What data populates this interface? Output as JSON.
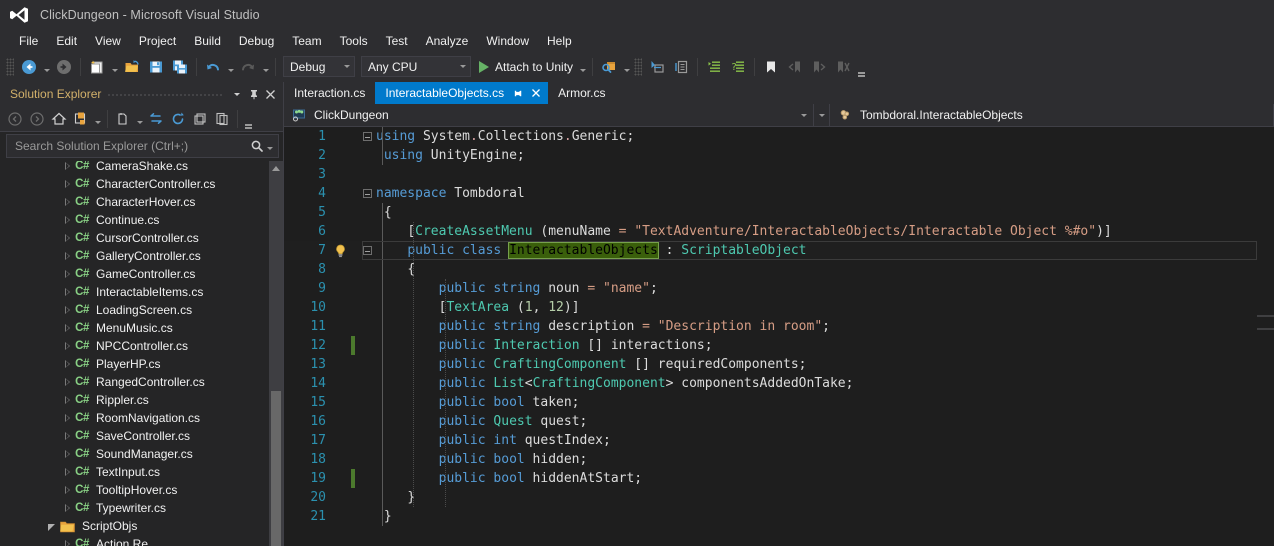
{
  "window": {
    "title": "ClickDungeon - Microsoft Visual Studio",
    "logo_icon": "visual-studio-logo"
  },
  "menubar": {
    "items": [
      {
        "label": "File"
      },
      {
        "label": "Edit"
      },
      {
        "label": "View"
      },
      {
        "label": "Project"
      },
      {
        "label": "Build"
      },
      {
        "label": "Debug"
      },
      {
        "label": "Team"
      },
      {
        "label": "Tools"
      },
      {
        "label": "Test"
      },
      {
        "label": "Analyze"
      },
      {
        "label": "Window"
      },
      {
        "label": "Help"
      }
    ]
  },
  "toolbar": {
    "navigate_back_icon": "navigate-back-icon",
    "navigate_forward_icon": "navigate-forward-icon",
    "new_project_icon": "new-project-icon",
    "open_file_icon": "open-file-icon",
    "save_icon": "save-icon",
    "save_all_icon": "save-all-icon",
    "undo_icon": "undo-icon",
    "redo_icon": "redo-icon",
    "config_value": "Debug",
    "platform_value": "Any CPU",
    "run_label": "Attach to Unity",
    "run_icon": "play-icon",
    "find_icon": "find-in-files-icon",
    "step_icon": "step-into-icon",
    "doc_outline_icon": "document-outline-icon",
    "indent_icon": "indent-icon",
    "comment_icon": "comment-icon",
    "bookmark_icon": "bookmark-icon",
    "prev_bookmark_icon": "previous-bookmark-icon",
    "next_bookmark_icon": "next-bookmark-icon",
    "clear_bookmarks_icon": "clear-bookmarks-icon",
    "overflow_icon": "toolbar-overflow-icon"
  },
  "solution_explorer": {
    "title": "Solution Explorer",
    "dropdown_icon": "chevron-down-icon",
    "pin_icon": "pin-icon",
    "close_icon": "close-icon",
    "toolbar": {
      "back_icon": "back-icon",
      "forward_icon": "forward-icon",
      "home_icon": "home-icon",
      "pending_changes_icon": "pending-changes-icon",
      "pending_dropdown_icon": "chevron-down-icon",
      "show_all_files_icon": "show-all-files-icon",
      "show_all_dropdown_icon": "chevron-down-icon",
      "sync_icon": "sync-with-active-document-icon",
      "refresh_icon": "refresh-icon",
      "collapse_all_icon": "collapse-all-icon",
      "properties_icon": "properties-icon",
      "overflow_icon": "toolbar-overflow-icon"
    },
    "search": {
      "placeholder": "Search Solution Explorer (Ctrl+;)",
      "value": "",
      "search_icon": "search-icon",
      "dropdown_icon": "chevron-down-icon"
    },
    "tree": [
      {
        "label": "CameraShake.cs",
        "type": "cs",
        "expander": "collapsed",
        "indent": 3
      },
      {
        "label": "CharacterController.cs",
        "type": "cs",
        "expander": "collapsed",
        "indent": 3
      },
      {
        "label": "CharacterHover.cs",
        "type": "cs",
        "expander": "collapsed",
        "indent": 3
      },
      {
        "label": "Continue.cs",
        "type": "cs",
        "expander": "collapsed",
        "indent": 3
      },
      {
        "label": "CursorController.cs",
        "type": "cs",
        "expander": "collapsed",
        "indent": 3
      },
      {
        "label": "GalleryController.cs",
        "type": "cs",
        "expander": "collapsed",
        "indent": 3
      },
      {
        "label": "GameController.cs",
        "type": "cs",
        "expander": "collapsed",
        "indent": 3
      },
      {
        "label": "InteractableItems.cs",
        "type": "cs",
        "expander": "collapsed",
        "indent": 3
      },
      {
        "label": "LoadingScreen.cs",
        "type": "cs",
        "expander": "collapsed",
        "indent": 3
      },
      {
        "label": "MenuMusic.cs",
        "type": "cs",
        "expander": "collapsed",
        "indent": 3
      },
      {
        "label": "NPCController.cs",
        "type": "cs",
        "expander": "collapsed",
        "indent": 3
      },
      {
        "label": "PlayerHP.cs",
        "type": "cs",
        "expander": "collapsed",
        "indent": 3
      },
      {
        "label": "RangedController.cs",
        "type": "cs",
        "expander": "collapsed",
        "indent": 3
      },
      {
        "label": "Rippler.cs",
        "type": "cs",
        "expander": "collapsed",
        "indent": 3
      },
      {
        "label": "RoomNavigation.cs",
        "type": "cs",
        "expander": "collapsed",
        "indent": 3
      },
      {
        "label": "SaveController.cs",
        "type": "cs",
        "expander": "collapsed",
        "indent": 3
      },
      {
        "label": "SoundManager.cs",
        "type": "cs",
        "expander": "collapsed",
        "indent": 3
      },
      {
        "label": "TextInput.cs",
        "type": "cs",
        "expander": "collapsed",
        "indent": 3
      },
      {
        "label": "TooltipHover.cs",
        "type": "cs",
        "expander": "collapsed",
        "indent": 3
      },
      {
        "label": "Typewriter.cs",
        "type": "cs",
        "expander": "collapsed",
        "indent": 3
      },
      {
        "label": "ScriptObjs",
        "type": "folder",
        "expander": "expanded",
        "indent": 2
      },
      {
        "label": "Action.Re",
        "type": "cs",
        "expander": "collapsed",
        "indent": 3
      }
    ],
    "scrollbar": {
      "up_arrow_icon": "scroll-up-arrow-icon"
    }
  },
  "editor": {
    "tabs": [
      {
        "label": "Interaction.cs",
        "active": false
      },
      {
        "label": "InteractableObjects.cs",
        "active": true,
        "pin_icon": "pin-icon",
        "close_icon": "close-icon"
      },
      {
        "label": "Armor.cs",
        "active": false
      }
    ],
    "navbar": {
      "project_value": "ClickDungeon",
      "project_icon": "project-icon",
      "project_dropdown_icon": "chevron-down-icon",
      "type_value": "Tombdoral.InteractableObjects",
      "type_icon": "class-icon",
      "type_dropdown_icon": "chevron-down-icon"
    },
    "colors": {
      "background": "#1e1e1e",
      "line_number": "#2b91af",
      "keyword": "#569cd6",
      "type": "#4ec9b0",
      "string": "#d69d85",
      "number": "#b5cea8",
      "plain": "#dcdcdc",
      "selection_highlight": "#3a5f0b",
      "change_bar": "#4c7a2d",
      "tab_active": "#007acc"
    },
    "lines": [
      {
        "n": 1,
        "fold": "collapse-minus",
        "indent_guides": 0,
        "tokens": [
          {
            "t": "using ",
            "c": "kw"
          },
          {
            "t": "System",
            "c": "pln"
          },
          {
            "t": ".",
            "c": "dot"
          },
          {
            "t": "Collections",
            "c": "pln"
          },
          {
            "t": ".",
            "c": "dot"
          },
          {
            "t": "Generic",
            "c": "pln"
          },
          {
            "t": ";",
            "c": "pln"
          }
        ]
      },
      {
        "n": 2,
        "fold": "",
        "indent_guides": 0,
        "tokens": [
          {
            "t": "using ",
            "c": "kw"
          },
          {
            "t": "UnityEngine;",
            "c": "pln"
          }
        ]
      },
      {
        "n": 3,
        "fold": "",
        "indent_guides": 0,
        "tokens": []
      },
      {
        "n": 4,
        "fold": "collapse-minus",
        "indent_guides": 0,
        "tokens": [
          {
            "t": "namespace ",
            "c": "kw"
          },
          {
            "t": "Tombdoral",
            "c": "pln"
          }
        ]
      },
      {
        "n": 5,
        "fold": "",
        "indent_guides": 0,
        "tokens": [
          {
            "t": "{",
            "c": "pln"
          }
        ]
      },
      {
        "n": 6,
        "fold": "",
        "indent_guides": 1,
        "tokens": [
          {
            "t": "[",
            "c": "pln"
          },
          {
            "t": "CreateAssetMenu",
            "c": "typ"
          },
          {
            "t": " (",
            "c": "pln"
          },
          {
            "t": "menuName",
            "c": "pln"
          },
          {
            "t": " = ",
            "c": "str"
          },
          {
            "t": "\"TextAdventure/InteractableObjects/Interactable Object %#o\"",
            "c": "str"
          },
          {
            "t": ")]",
            "c": "pln"
          }
        ]
      },
      {
        "n": 7,
        "fold": "collapse-minus",
        "bulb": true,
        "current": true,
        "indent_guides": 1,
        "tokens": [
          {
            "t": "public class ",
            "c": "kw"
          },
          {
            "t": "InteractableObjects",
            "c": "sel"
          },
          {
            "t": " : ",
            "c": "pln"
          },
          {
            "t": "ScriptableObject",
            "c": "typ"
          }
        ]
      },
      {
        "n": 8,
        "fold": "",
        "indent_guides": 1,
        "tokens": [
          {
            "t": "{",
            "c": "pln"
          }
        ]
      },
      {
        "n": 9,
        "fold": "",
        "indent_guides": 2,
        "tokens": [
          {
            "t": "public string ",
            "c": "kw"
          },
          {
            "t": "noun ",
            "c": "pln"
          },
          {
            "t": "= ",
            "c": "str"
          },
          {
            "t": "\"name\"",
            "c": "str"
          },
          {
            "t": ";",
            "c": "pln"
          }
        ]
      },
      {
        "n": 10,
        "fold": "",
        "indent_guides": 2,
        "tokens": [
          {
            "t": "[",
            "c": "pln"
          },
          {
            "t": "TextArea",
            "c": "typ"
          },
          {
            "t": " (",
            "c": "pln"
          },
          {
            "t": "1",
            "c": "num"
          },
          {
            "t": ", ",
            "c": "pln"
          },
          {
            "t": "12",
            "c": "num"
          },
          {
            "t": ")]",
            "c": "pln"
          }
        ]
      },
      {
        "n": 11,
        "fold": "",
        "indent_guides": 2,
        "tokens": [
          {
            "t": "public string ",
            "c": "kw"
          },
          {
            "t": "description ",
            "c": "pln"
          },
          {
            "t": "= ",
            "c": "str"
          },
          {
            "t": "\"Description in room\"",
            "c": "str"
          },
          {
            "t": ";",
            "c": "pln"
          }
        ]
      },
      {
        "n": 12,
        "fold": "",
        "change": true,
        "indent_guides": 2,
        "tokens": [
          {
            "t": "public ",
            "c": "kw"
          },
          {
            "t": "Interaction",
            "c": "typ"
          },
          {
            "t": " [] interactions;",
            "c": "pln"
          }
        ]
      },
      {
        "n": 13,
        "fold": "",
        "indent_guides": 2,
        "tokens": [
          {
            "t": "public ",
            "c": "kw"
          },
          {
            "t": "CraftingComponent",
            "c": "typ"
          },
          {
            "t": " [] requiredComponents;",
            "c": "pln"
          }
        ]
      },
      {
        "n": 14,
        "fold": "",
        "indent_guides": 2,
        "tokens": [
          {
            "t": "public ",
            "c": "kw"
          },
          {
            "t": "List",
            "c": "typ"
          },
          {
            "t": "<",
            "c": "pln"
          },
          {
            "t": "CraftingComponent",
            "c": "typ"
          },
          {
            "t": "> componentsAddedOnTake;",
            "c": "pln"
          }
        ]
      },
      {
        "n": 15,
        "fold": "",
        "indent_guides": 2,
        "tokens": [
          {
            "t": "public bool ",
            "c": "kw"
          },
          {
            "t": "taken;",
            "c": "pln"
          }
        ]
      },
      {
        "n": 16,
        "fold": "",
        "indent_guides": 2,
        "tokens": [
          {
            "t": "public ",
            "c": "kw"
          },
          {
            "t": "Quest",
            "c": "typ"
          },
          {
            "t": " quest;",
            "c": "pln"
          }
        ]
      },
      {
        "n": 17,
        "fold": "",
        "indent_guides": 2,
        "tokens": [
          {
            "t": "public int ",
            "c": "kw"
          },
          {
            "t": "questIndex;",
            "c": "pln"
          }
        ]
      },
      {
        "n": 18,
        "fold": "",
        "indent_guides": 2,
        "tokens": [
          {
            "t": "public bool ",
            "c": "kw"
          },
          {
            "t": "hidden;",
            "c": "pln"
          }
        ]
      },
      {
        "n": 19,
        "fold": "",
        "change": true,
        "indent_guides": 2,
        "tokens": [
          {
            "t": "public bool ",
            "c": "kw"
          },
          {
            "t": "hiddenAtStart;",
            "c": "pln"
          }
        ]
      },
      {
        "n": 20,
        "fold": "",
        "indent_guides": 1,
        "tokens": [
          {
            "t": "}",
            "c": "pln"
          }
        ]
      },
      {
        "n": 21,
        "fold": "",
        "indent_guides": 0,
        "tokens": [
          {
            "t": "}",
            "c": "pln"
          }
        ]
      }
    ]
  }
}
